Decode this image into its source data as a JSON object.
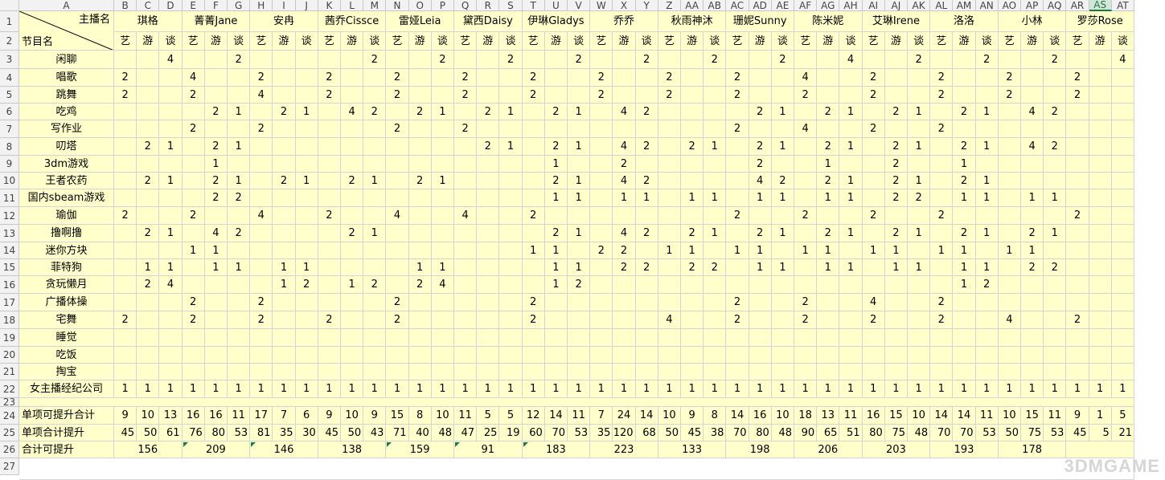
{
  "columns": [
    "A",
    "B",
    "C",
    "D",
    "E",
    "F",
    "G",
    "H",
    "I",
    "J",
    "K",
    "L",
    "M",
    "N",
    "O",
    "P",
    "Q",
    "R",
    "S",
    "T",
    "U",
    "V",
    "W",
    "X",
    "Y",
    "Z",
    "AA",
    "AB",
    "AC",
    "AD",
    "AE",
    "AF",
    "AG",
    "AH",
    "AI",
    "AJ",
    "AK",
    "AL",
    "AM",
    "AN",
    "AO",
    "AP",
    "AQ",
    "AR",
    "AS",
    "AT"
  ],
  "selected_column": "AS",
  "row_numbers": [
    "1",
    "2",
    "3",
    "4",
    "5",
    "6",
    "7",
    "8",
    "9",
    "10",
    "11",
    "12",
    "13",
    "14",
    "15",
    "16",
    "17",
    "18",
    "19",
    "20",
    "21",
    "22",
    "23",
    "24",
    "25",
    "26",
    "27"
  ],
  "header": {
    "corner_top": "主播名",
    "corner_bottom": "节目名",
    "streamers": [
      "琪格",
      "菁菁Jane",
      "安冉",
      "茜乔Cissce",
      "雷娅Leia",
      "黛西Daisy",
      "伊琳Gladys",
      "乔乔",
      "秋雨神沐",
      "珊妮Sunny",
      "陈米妮",
      "艾琳Irene",
      "洛洛",
      "小林",
      "罗莎Rose"
    ],
    "categories": [
      "艺",
      "游",
      "谈"
    ]
  },
  "rows": [
    {
      "name": "闲聊",
      "values": [
        "",
        "",
        "4",
        "",
        "",
        "2",
        "",
        "",
        "",
        "",
        "",
        "2",
        "",
        "",
        "2",
        "",
        "",
        "2",
        "",
        "",
        "2",
        "",
        "",
        "2",
        "",
        "",
        "2",
        "",
        "",
        "2",
        "",
        "",
        "4",
        "",
        "",
        "2",
        "",
        "",
        "2",
        "",
        "",
        "2",
        "",
        "",
        "4"
      ]
    },
    {
      "name": "唱歌",
      "values": [
        "2",
        "",
        "",
        "4",
        "",
        "",
        "2",
        "",
        "",
        "2",
        "",
        "",
        "2",
        "",
        "",
        "2",
        "",
        "",
        "2",
        "",
        "",
        "2",
        "",
        "",
        "2",
        "",
        "",
        "2",
        "",
        "",
        "4",
        "",
        "",
        "2",
        "",
        "",
        "2",
        "",
        "",
        "2",
        "",
        "",
        "2",
        "",
        ""
      ]
    },
    {
      "name": "跳舞",
      "values": [
        "2",
        "",
        "",
        "2",
        "",
        "",
        "4",
        "",
        "",
        "2",
        "",
        "",
        "2",
        "",
        "",
        "2",
        "",
        "",
        "2",
        "",
        "",
        "2",
        "",
        "",
        "2",
        "",
        "",
        "2",
        "",
        "",
        "2",
        "",
        "",
        "2",
        "",
        "",
        "2",
        "",
        "",
        "2",
        "",
        "",
        "2",
        "",
        ""
      ]
    },
    {
      "name": "吃鸡",
      "values": [
        "",
        "",
        "",
        "",
        "2",
        "1",
        "",
        "2",
        "1",
        "",
        "4",
        "2",
        "",
        "2",
        "1",
        "",
        "2",
        "1",
        "",
        "2",
        "1",
        "",
        "4",
        "2",
        "",
        "",
        "",
        "",
        "2",
        "1",
        "",
        "2",
        "1",
        "",
        "2",
        "1",
        "",
        "2",
        "1",
        "",
        "4",
        "2",
        "",
        "",
        ""
      ]
    },
    {
      "name": "写作业",
      "values": [
        "",
        "",
        "",
        "2",
        "",
        "",
        "2",
        "",
        "",
        "",
        "",
        "",
        "2",
        "",
        "",
        "2",
        "",
        "",
        "",
        "",
        "",
        "",
        "",
        "",
        "",
        "",
        "",
        "2",
        "",
        "",
        "4",
        "",
        "",
        "2",
        "",
        "",
        "2",
        "",
        "",
        "",
        "",
        "",
        "",
        "",
        ""
      ]
    },
    {
      "name": "叨塔",
      "values": [
        "",
        "2",
        "1",
        "",
        "2",
        "1",
        "",
        "",
        "",
        "",
        "",
        "",
        "",
        "",
        "",
        "",
        "2",
        "1",
        "",
        "2",
        "1",
        "",
        "4",
        "2",
        "",
        "2",
        "1",
        "",
        "2",
        "1",
        "",
        "2",
        "1",
        "",
        "2",
        "1",
        "",
        "2",
        "1",
        "",
        "4",
        "2",
        "",
        "",
        ""
      ]
    },
    {
      "name": "3dm游戏",
      "values": [
        "",
        "",
        "",
        "",
        "1",
        "",
        "",
        "",
        "",
        "",
        "",
        "",
        "",
        "",
        "",
        "",
        "",
        "",
        "",
        "1",
        "",
        "",
        "2",
        "",
        "",
        "",
        "",
        "",
        "2",
        "",
        "",
        "1",
        "",
        "",
        "2",
        "",
        "",
        "1",
        "",
        "",
        "",
        "",
        "",
        "",
        ""
      ]
    },
    {
      "name": "王者农药",
      "values": [
        "",
        "2",
        "1",
        "",
        "2",
        "1",
        "",
        "2",
        "1",
        "",
        "2",
        "1",
        "",
        "2",
        "1",
        "",
        "",
        "",
        "",
        "2",
        "1",
        "",
        "4",
        "2",
        "",
        "",
        "",
        "",
        "4",
        "2",
        "",
        "2",
        "1",
        "",
        "2",
        "1",
        "",
        "2",
        "1",
        "",
        "",
        "",
        "",
        "",
        ""
      ]
    },
    {
      "name": "国内sbeam游戏",
      "values": [
        "",
        "",
        "",
        "",
        "2",
        "2",
        "",
        "",
        "",
        "",
        "",
        "",
        "",
        "",
        "",
        "",
        "",
        "",
        "",
        "1",
        "1",
        "",
        "1",
        "1",
        "",
        "1",
        "1",
        "",
        "1",
        "1",
        "",
        "1",
        "1",
        "",
        "2",
        "2",
        "",
        "1",
        "1",
        "",
        "1",
        "1",
        "",
        "",
        ""
      ]
    },
    {
      "name": "瑜伽",
      "values": [
        "2",
        "",
        "",
        "2",
        "",
        "",
        "4",
        "",
        "",
        "2",
        "",
        "",
        "4",
        "",
        "",
        "4",
        "",
        "",
        "2",
        "",
        "",
        "",
        "",
        "",
        "",
        "",
        "",
        "2",
        "",
        "",
        "2",
        "",
        "",
        "2",
        "",
        "",
        "2",
        "",
        "",
        "",
        "",
        "",
        "2",
        "",
        ""
      ]
    },
    {
      "name": "撸啊撸",
      "values": [
        "",
        "2",
        "1",
        "",
        "4",
        "2",
        "",
        "",
        "",
        "",
        "2",
        "1",
        "",
        "",
        "",
        "",
        "",
        "",
        "",
        "2",
        "1",
        "",
        "4",
        "2",
        "",
        "2",
        "1",
        "",
        "2",
        "1",
        "",
        "2",
        "1",
        "",
        "2",
        "1",
        "",
        "2",
        "1",
        "",
        "2",
        "1",
        "",
        "",
        ""
      ]
    },
    {
      "name": "迷你方块",
      "values": [
        "",
        "",
        "",
        "1",
        "1",
        "",
        "",
        "",
        "",
        "",
        "",
        "",
        "",
        "",
        "",
        "",
        "",
        "",
        "1",
        "1",
        "",
        "2",
        "2",
        "",
        "1",
        "1",
        "",
        "1",
        "1",
        "",
        "1",
        "1",
        "",
        "1",
        "1",
        "",
        "1",
        "1",
        "",
        "1",
        "1",
        "",
        "",
        "",
        ""
      ]
    },
    {
      "name": "菲特狗",
      "values": [
        "",
        "1",
        "1",
        "",
        "1",
        "1",
        "",
        "1",
        "1",
        "",
        "",
        "",
        "",
        "1",
        "1",
        "",
        "",
        "",
        "",
        "1",
        "1",
        "",
        "2",
        "2",
        "",
        "2",
        "2",
        "",
        "1",
        "1",
        "",
        "1",
        "1",
        "",
        "1",
        "1",
        "",
        "1",
        "1",
        "",
        "2",
        "2",
        "",
        "",
        ""
      ]
    },
    {
      "name": "贪玩懒月",
      "values": [
        "",
        "2",
        "4",
        "",
        "",
        "",
        "",
        "1",
        "2",
        "",
        "1",
        "2",
        "",
        "2",
        "4",
        "",
        "",
        "",
        "",
        "1",
        "2",
        "",
        "",
        "",
        "",
        "",
        "",
        "",
        "",
        "",
        "",
        "",
        "",
        "",
        "",
        "",
        "",
        "1",
        "2",
        "",
        "",
        "",
        "",
        "",
        ""
      ]
    },
    {
      "name": "广播体操",
      "values": [
        "",
        "",
        "",
        "2",
        "",
        "",
        "2",
        "",
        "",
        "",
        "",
        "",
        "2",
        "",
        "",
        "",
        "",
        "",
        "2",
        "",
        "",
        "",
        "",
        "",
        "",
        "",
        "",
        "2",
        "",
        "",
        "2",
        "",
        "",
        "4",
        "",
        "",
        "2",
        "",
        "",
        "",
        "",
        "",
        "",
        "",
        ""
      ]
    },
    {
      "name": "宅舞",
      "values": [
        "2",
        "",
        "",
        "2",
        "",
        "",
        "2",
        "",
        "",
        "2",
        "",
        "",
        "2",
        "",
        "",
        "",
        "",
        "",
        "2",
        "",
        "",
        "",
        "",
        "",
        "4",
        "",
        "",
        "2",
        "",
        "",
        "2",
        "",
        "",
        "2",
        "",
        "",
        "2",
        "",
        "",
        "4",
        "",
        "",
        "2",
        "",
        ""
      ]
    },
    {
      "name": "睡觉",
      "values": [
        "",
        "",
        "",
        "",
        "",
        "",
        "",
        "",
        "",
        "",
        "",
        "",
        "",
        "",
        "",
        "",
        "",
        "",
        "",
        "",
        "",
        "",
        "",
        "",
        "",
        "",
        "",
        "",
        "",
        "",
        "",
        "",
        "",
        "",
        "",
        "",
        "",
        "",
        "",
        "",
        "",
        "",
        "",
        "",
        ""
      ]
    },
    {
      "name": "吃饭",
      "values": [
        "",
        "",
        "",
        "",
        "",
        "",
        "",
        "",
        "",
        "",
        "",
        "",
        "",
        "",
        "",
        "",
        "",
        "",
        "",
        "",
        "",
        "",
        "",
        "",
        "",
        "",
        "",
        "",
        "",
        "",
        "",
        "",
        "",
        "",
        "",
        "",
        "",
        "",
        "",
        "",
        "",
        "",
        "",
        "",
        ""
      ]
    },
    {
      "name": "掏宝",
      "values": [
        "",
        "",
        "",
        "",
        "",
        "",
        "",
        "",
        "",
        "",
        "",
        "",
        "",
        "",
        "",
        "",
        "",
        "",
        "",
        "",
        "",
        "",
        "",
        "",
        "",
        "",
        "",
        "",
        "",
        "",
        "",
        "",
        "",
        "",
        "",
        "",
        "",
        "",
        "",
        "",
        "",
        "",
        "",
        "",
        ""
      ]
    },
    {
      "name": "女主播经纪公司",
      "values": [
        "1",
        "1",
        "1",
        "1",
        "1",
        "1",
        "1",
        "1",
        "1",
        "1",
        "1",
        "1",
        "1",
        "1",
        "1",
        "1",
        "1",
        "1",
        "1",
        "1",
        "1",
        "1",
        "1",
        "1",
        "1",
        "1",
        "1",
        "1",
        "1",
        "1",
        "1",
        "1",
        "1",
        "1",
        "1",
        "1",
        "1",
        "1",
        "1",
        "1",
        "1",
        "1",
        "1",
        "1",
        "1"
      ]
    }
  ],
  "summary": {
    "label_24": "单项可提升合计",
    "values_24": [
      "9",
      "10",
      "13",
      "16",
      "16",
      "11",
      "17",
      "7",
      "6",
      "9",
      "10",
      "9",
      "15",
      "8",
      "10",
      "11",
      "5",
      "5",
      "12",
      "14",
      "11",
      "7",
      "24",
      "14",
      "10",
      "9",
      "8",
      "14",
      "16",
      "10",
      "18",
      "13",
      "11",
      "16",
      "15",
      "10",
      "14",
      "14",
      "11",
      "10",
      "15",
      "11",
      "9",
      "1",
      "5"
    ],
    "label_25": "单项合计提升",
    "values_25": [
      "45",
      "50",
      "61",
      "76",
      "80",
      "53",
      "81",
      "35",
      "30",
      "45",
      "50",
      "43",
      "71",
      "40",
      "48",
      "47",
      "25",
      "19",
      "60",
      "70",
      "53",
      "35",
      "120",
      "68",
      "50",
      "45",
      "38",
      "70",
      "80",
      "48",
      "90",
      "65",
      "51",
      "80",
      "75",
      "48",
      "70",
      "70",
      "53",
      "50",
      "75",
      "53",
      "45",
      "5",
      "21"
    ],
    "label_26": "合计可提升",
    "totals_26": [
      "156",
      "209",
      "146",
      "138",
      "159",
      "91",
      "183",
      "223",
      "133",
      "198",
      "206",
      "203",
      "193",
      "178",
      ""
    ]
  },
  "watermark": "3DMGAME",
  "colors": {
    "cell_fill": "#ffffcc",
    "grid": "#d4d4d4",
    "header_bg": "#f2f2f2",
    "selected_header": "#217346"
  }
}
